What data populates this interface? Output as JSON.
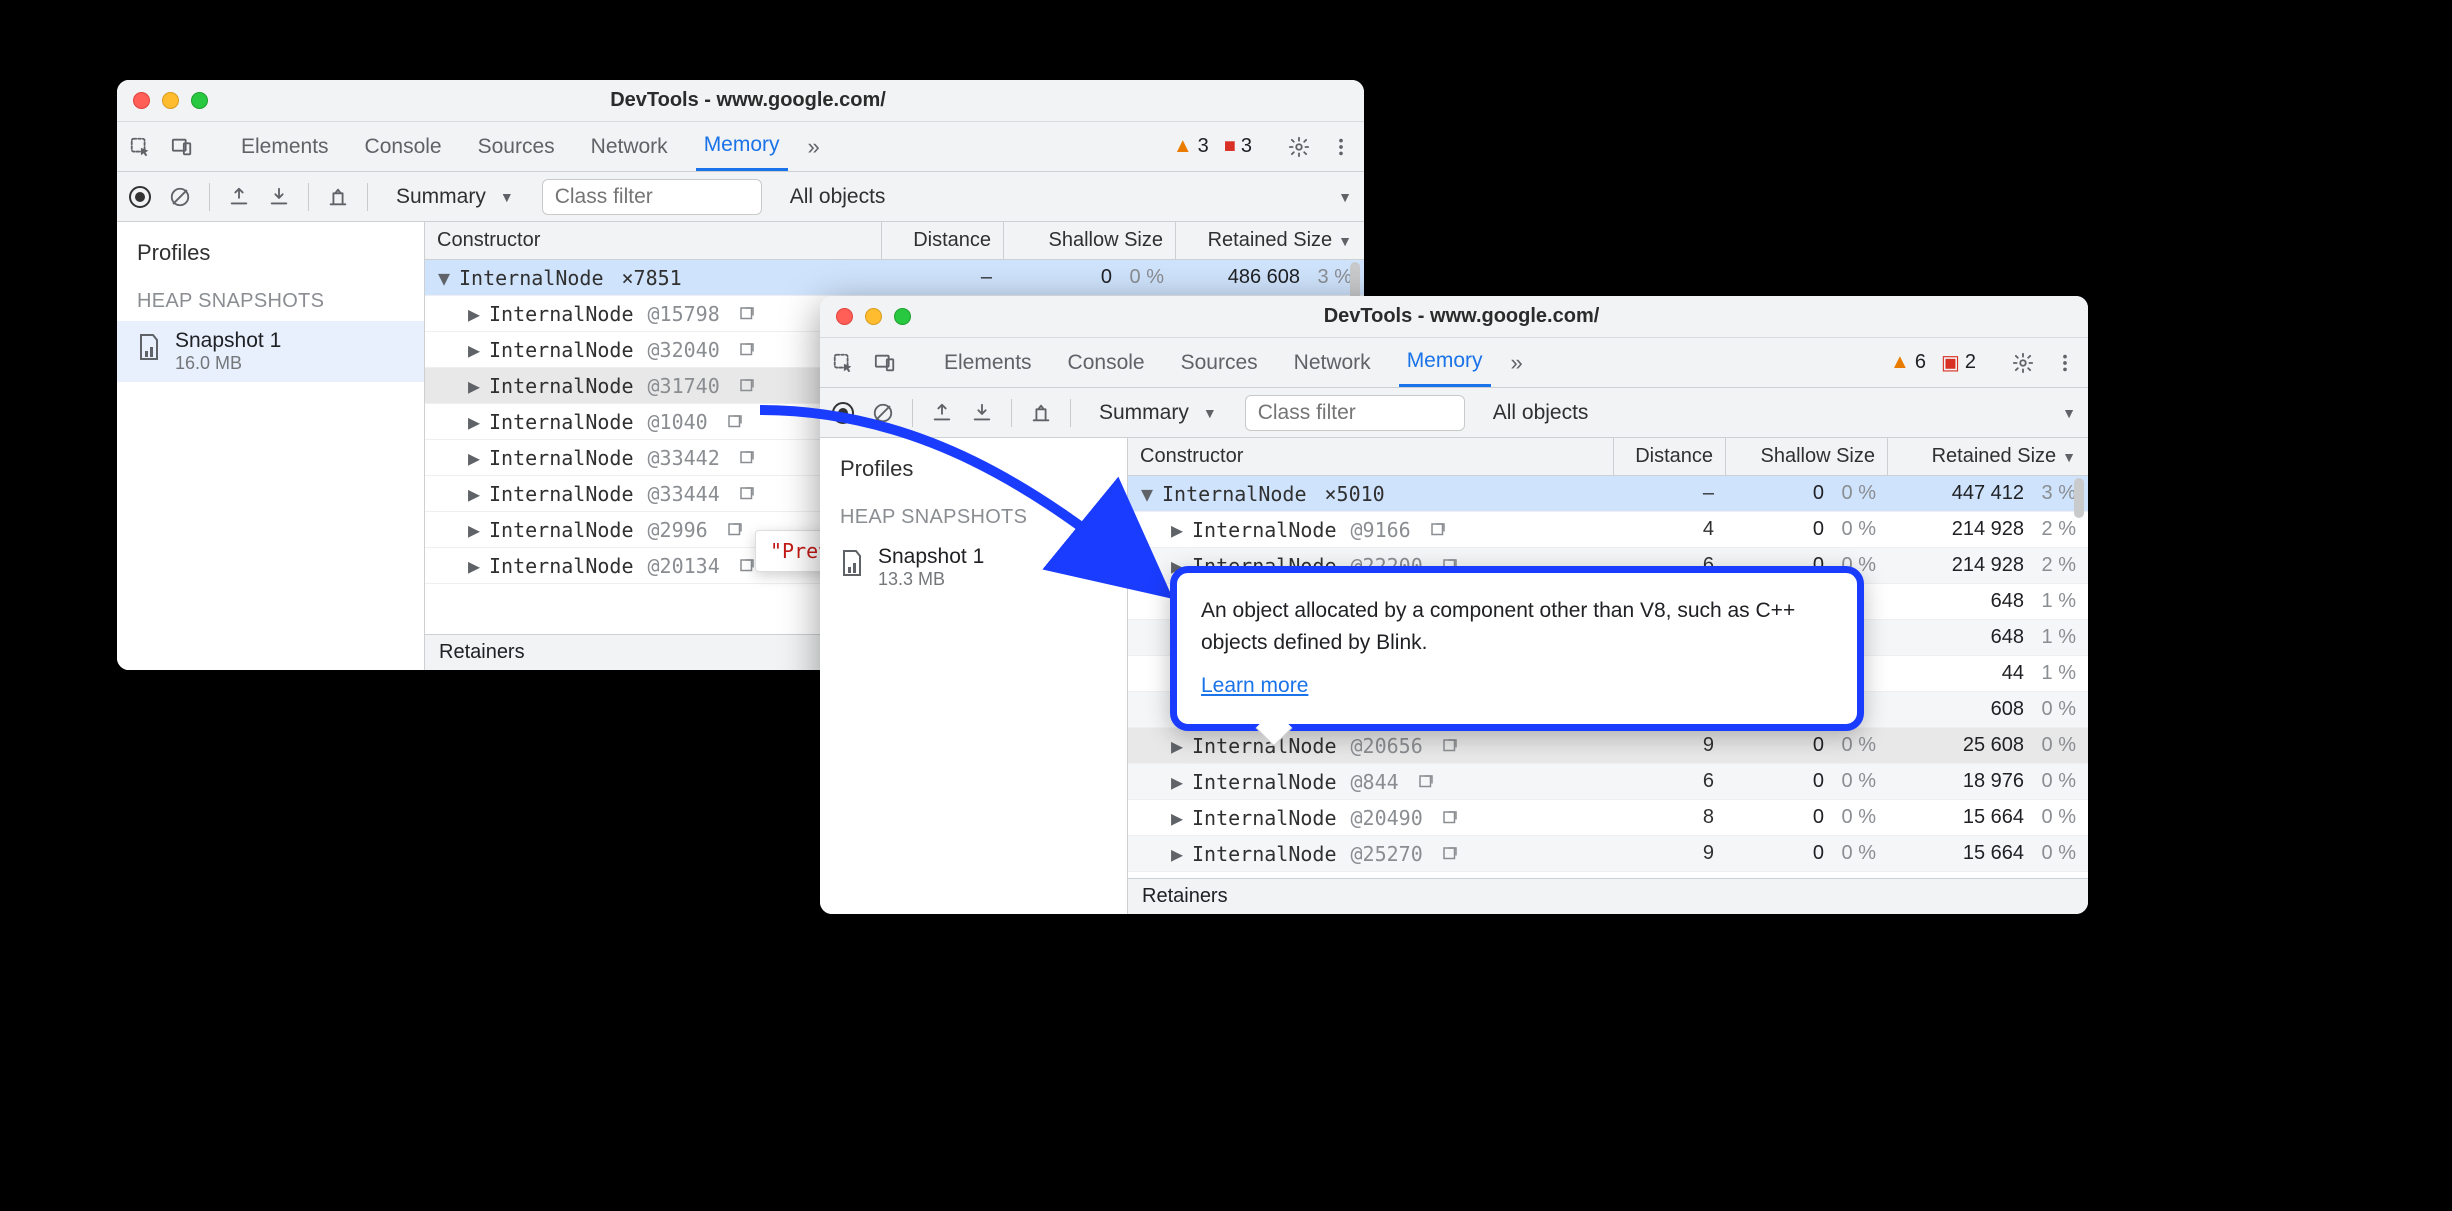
{
  "window1": {
    "title": "DevTools - www.google.com/",
    "tabs": [
      "Elements",
      "Console",
      "Sources",
      "Network",
      "Memory"
    ],
    "active_tab": "Memory",
    "warn_count": "3",
    "error_count": "3",
    "summary_label": "Summary",
    "class_filter_placeholder": "Class filter",
    "objects_filter": "All objects",
    "sidebar": {
      "profiles_label": "Profiles",
      "section_label": "HEAP SNAPSHOTS",
      "snapshot_name": "Snapshot 1",
      "snapshot_size": "16.0 MB"
    },
    "columns": {
      "constructor": "Constructor",
      "distance": "Distance",
      "shallow": "Shallow Size",
      "retained": "Retained Size"
    },
    "head_row": {
      "name": "InternalNode",
      "count": "×7851",
      "distance": "–",
      "shallow": "0",
      "shallow_pct": "0 %",
      "retained": "486 608",
      "retained_pct": "3 %"
    },
    "rows": [
      {
        "name": "InternalNode",
        "id": "@15798"
      },
      {
        "name": "InternalNode",
        "id": "@32040"
      },
      {
        "name": "InternalNode",
        "id": "@31740"
      },
      {
        "name": "InternalNode",
        "id": "@1040"
      },
      {
        "name": "InternalNode",
        "id": "@33442"
      },
      {
        "name": "InternalNode",
        "id": "@33444"
      },
      {
        "name": "InternalNode",
        "id": "@2996"
      },
      {
        "name": "InternalNode",
        "id": "@20134"
      }
    ],
    "tooltip_text": "\"Preview is not available\"",
    "retainers_label": "Retainers"
  },
  "window2": {
    "title": "DevTools - www.google.com/",
    "tabs": [
      "Elements",
      "Console",
      "Sources",
      "Network",
      "Memory"
    ],
    "active_tab": "Memory",
    "warn_count": "6",
    "error_count": "2",
    "summary_label": "Summary",
    "class_filter_placeholder": "Class filter",
    "objects_filter": "All objects",
    "sidebar": {
      "profiles_label": "Profiles",
      "section_label": "HEAP SNAPSHOTS",
      "snapshot_name": "Snapshot 1",
      "snapshot_size": "13.3 MB"
    },
    "columns": {
      "constructor": "Constructor",
      "distance": "Distance",
      "shallow": "Shallow Size",
      "retained": "Retained Size"
    },
    "head_row": {
      "name": "InternalNode",
      "count": "×5010",
      "distance": "–",
      "shallow": "0",
      "shallow_pct": "0 %",
      "retained": "447 412",
      "retained_pct": "3 %"
    },
    "rows": [
      {
        "name": "InternalNode",
        "id": "@9166",
        "distance": "4",
        "shallow": "0",
        "shallow_pct": "0 %",
        "retained": "214 928",
        "retained_pct": "2 %"
      },
      {
        "name": "InternalNode",
        "id": "@22200",
        "distance": "6",
        "shallow": "0",
        "shallow_pct": "0 %",
        "retained": "214 928",
        "retained_pct": "2 %"
      },
      {
        "name": "",
        "id": "",
        "distance": "",
        "shallow": "",
        "shallow_pct": "",
        "retained": "648",
        "retained_pct": "1 %"
      },
      {
        "name": "",
        "id": "",
        "distance": "",
        "shallow": "",
        "shallow_pct": "",
        "retained": "648",
        "retained_pct": "1 %"
      },
      {
        "name": "",
        "id": "",
        "distance": "",
        "shallow": "",
        "shallow_pct": "",
        "retained": "44",
        "retained_pct": "1 %"
      },
      {
        "name": "",
        "id": "",
        "distance": "",
        "shallow": "",
        "shallow_pct": "",
        "retained": "608",
        "retained_pct": "0 %"
      },
      {
        "name": "InternalNode",
        "id": "@20656",
        "distance": "9",
        "shallow": "0",
        "shallow_pct": "0 %",
        "retained": "25 608",
        "retained_pct": "0 %"
      },
      {
        "name": "InternalNode",
        "id": "@844",
        "distance": "6",
        "shallow": "0",
        "shallow_pct": "0 %",
        "retained": "18 976",
        "retained_pct": "0 %"
      },
      {
        "name": "InternalNode",
        "id": "@20490",
        "distance": "8",
        "shallow": "0",
        "shallow_pct": "0 %",
        "retained": "15 664",
        "retained_pct": "0 %"
      },
      {
        "name": "InternalNode",
        "id": "@25270",
        "distance": "9",
        "shallow": "0",
        "shallow_pct": "0 %",
        "retained": "15 664",
        "retained_pct": "0 %"
      }
    ],
    "tooltip_text": "An object allocated by a component other than V8, such as C++ objects defined by Blink.",
    "tooltip_link": "Learn more",
    "retainers_label": "Retainers"
  }
}
